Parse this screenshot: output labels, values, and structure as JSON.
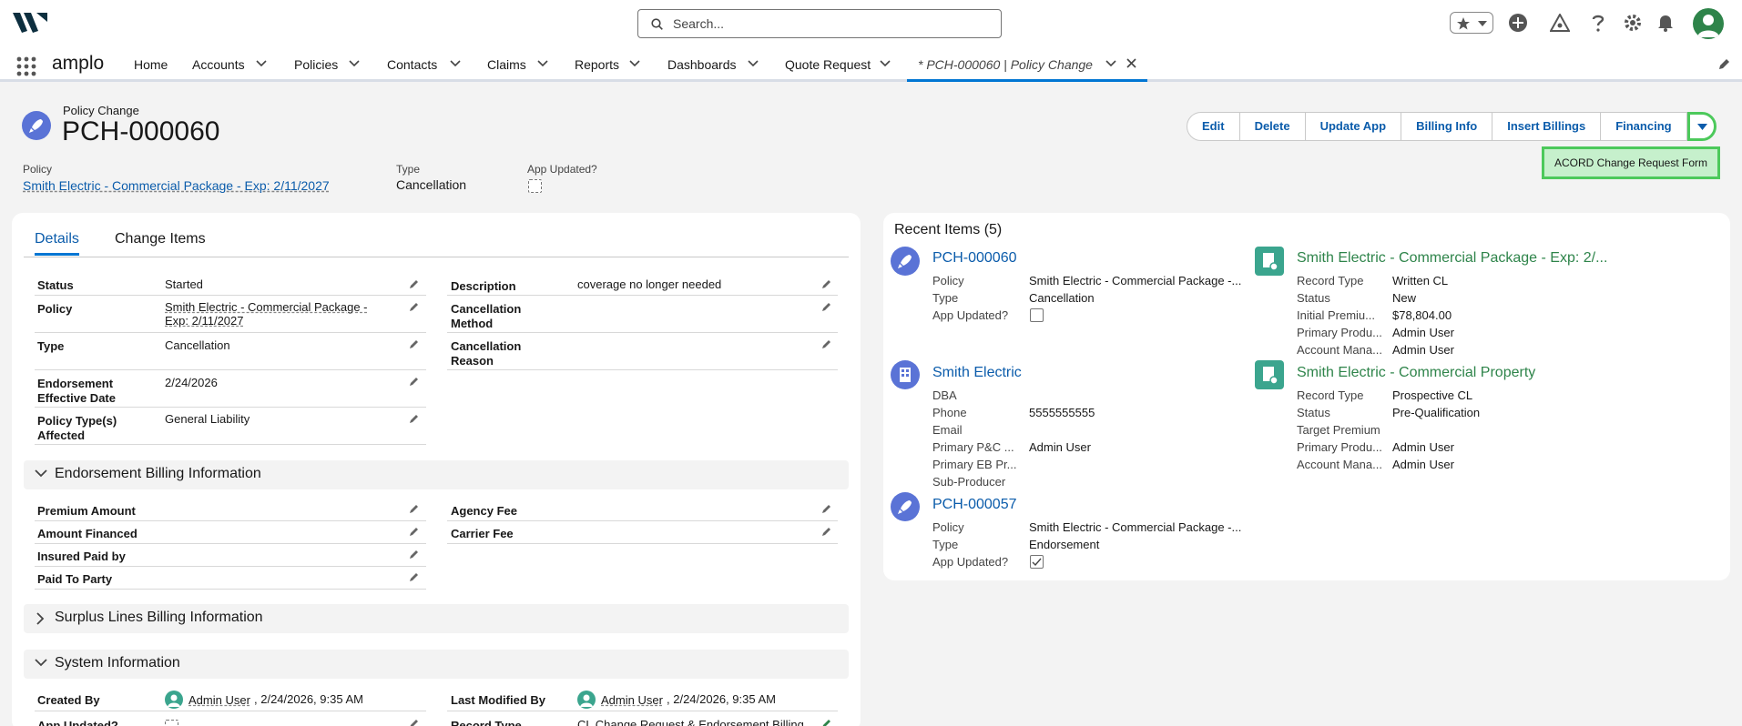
{
  "search": {
    "placeholder": "Search..."
  },
  "nav": {
    "app_name": "amplo",
    "items": [
      "Home",
      "Accounts",
      "Policies",
      "Contacts",
      "Claims",
      "Reports",
      "Dashboards",
      "Quote Request"
    ],
    "active_tab": "* PCH-000060 | Policy Change"
  },
  "record": {
    "object_label": "Policy Change",
    "title": "PCH-000060",
    "highlights": {
      "policy_label": "Policy",
      "policy_value": "Smith Electric - Commercial Package - Exp: 2/11/2027",
      "type_label": "Type",
      "type_value": "Cancellation",
      "app_updated_label": "App Updated?"
    }
  },
  "actions": {
    "buttons": [
      "Edit",
      "Delete",
      "Update App",
      "Billing Info",
      "Insert Billings",
      "Financing"
    ],
    "dropdown_item": "ACORD Change Request Form"
  },
  "details": {
    "tabs": [
      "Details",
      "Change Items"
    ],
    "left_fields": [
      {
        "label": "Status",
        "value": "Started"
      },
      {
        "label": "Policy",
        "value": "Smith Electric - Commercial Package - Exp: 2/11/2027"
      },
      {
        "label": "Type",
        "value": "Cancellation"
      },
      {
        "label": "Endorsement Effective Date",
        "value": "2/24/2026"
      },
      {
        "label": "Policy Type(s) Affected",
        "value": "General Liability"
      }
    ],
    "right_fields": [
      {
        "label": "Description",
        "value": "coverage no longer needed"
      },
      {
        "label": "Cancellation Method",
        "value": ""
      },
      {
        "label": "Cancellation Reason",
        "value": ""
      }
    ],
    "sections": {
      "billing": "Endorsement Billing Information",
      "surplus": "Surplus Lines Billing Information",
      "system": "System Information"
    },
    "billing_left": [
      "Premium Amount",
      "Amount Financed",
      "Insured Paid by",
      "Paid To Party"
    ],
    "billing_right": [
      "Agency Fee",
      "Carrier Fee"
    ],
    "system": {
      "created_by_label": "Created By",
      "created_by_user": "Admin User",
      "created_by_date": ", 2/24/2026, 9:35 AM",
      "modified_by_label": "Last Modified By",
      "modified_by_user": "Admin User",
      "modified_by_date": ", 2/24/2026, 9:35 AM",
      "app_updated_label": "App Updated?",
      "record_type_label": "Record Type",
      "record_type_value": "CL Change Request & Endorsement Billing"
    }
  },
  "recent": {
    "title": "Recent Items (5)",
    "pch60": {
      "name": "PCH-000060",
      "policy_l": "Policy",
      "policy_v": "Smith Electric - Commercial Package -...",
      "type_l": "Type",
      "type_v": "Cancellation",
      "app_l": "App Updated?"
    },
    "smith": {
      "name": "Smith Electric",
      "dba_l": "DBA",
      "phone_l": "Phone",
      "phone_v": "5555555555",
      "email_l": "Email",
      "pc_l": "Primary P&C ...",
      "pc_v": "Admin User",
      "eb_l": "Primary EB Pr...",
      "sub_l": "Sub-Producer"
    },
    "pch57": {
      "name": "PCH-000057",
      "policy_l": "Policy",
      "policy_v": "Smith Electric - Commercial Package -...",
      "type_l": "Type",
      "type_v": "Endorsement",
      "app_l": "App Updated?"
    },
    "pkg": {
      "name": "Smith Electric - Commercial Package - Exp: 2/...",
      "rt_l": "Record Type",
      "rt_v": "Written CL",
      "st_l": "Status",
      "st_v": "New",
      "ip_l": "Initial Premiu...",
      "ip_v": "$78,804.00",
      "pp_l": "Primary Produ...",
      "pp_v": "Admin User",
      "am_l": "Account Mana...",
      "am_v": "Admin User"
    },
    "prop": {
      "name": "Smith Electric - Commercial Property",
      "rt_l": "Record Type",
      "rt_v": "Prospective CL",
      "st_l": "Status",
      "st_v": "Pre-Qualification",
      "tp_l": "Target Premium",
      "pp_l": "Primary Produ...",
      "pp_v": "Admin User",
      "am_l": "Account Mana...",
      "am_v": "Admin User"
    }
  },
  "colors": {
    "brand": "#0176d3",
    "link": "#0b5cab",
    "highlight": "#4cc95b"
  }
}
